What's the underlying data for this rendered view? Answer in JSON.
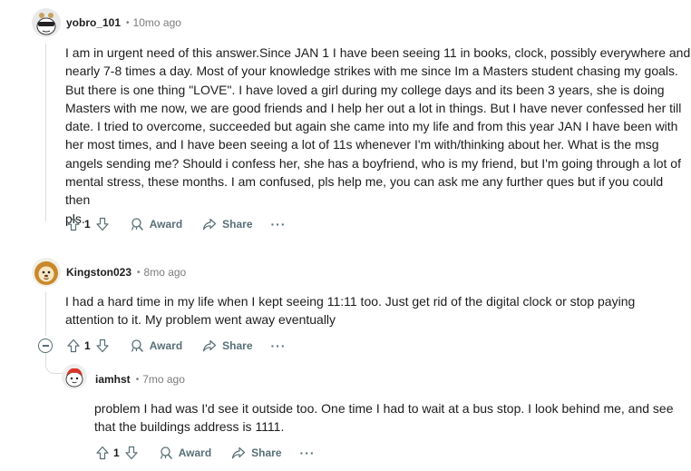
{
  "comments": [
    {
      "username": "yobro_101",
      "separator": "•",
      "time": "10mo ago",
      "avatar_icon": "snoo-avatar-shades",
      "lines": [
        "I am in urgent need of this answer.Since JAN 1 I have been seeing 11 in books, clock, possibly everywhere and",
        "nearly 7-8 times a day. Most of your knowledge strikes with me since Im a Masters student chasing my goals.",
        "But there is one thing \"LOVE\". I have loved a girl during my college days and its been 3 years, she is doing",
        "Masters with me now, we are good friends and I help her out a lot in things. But I have never confessed her till",
        "date. I tried to overcome, succeeded but again she came into my life and from this year JAN I have been with",
        "her most times, and I have been seeing a lot of 11s whenever I'm with/thinking about her. What is the msg",
        "angels sending me? Should i confess her, she has a boyfriend, who is my friend, but I'm going through a lot of",
        "mental stress, these months. I am confused, pls help me, you can ask me any further ques but if you could then",
        "pls."
      ],
      "votes": "1",
      "award_label": "Award",
      "share_label": "Share",
      "more_label": "···"
    },
    {
      "username": "Kingston023",
      "separator": "•",
      "time": "8mo ago",
      "avatar_icon": "snoo-avatar-lion",
      "lines": [
        "I had a hard time in my life when I kept seeing 11:11 too. Just get rid of the digital clock or stop paying",
        "attention to it. My problem went away eventually"
      ],
      "votes": "1",
      "award_label": "Award",
      "share_label": "Share",
      "more_label": "···"
    },
    {
      "username": "iamhst",
      "separator": "•",
      "time": "7mo ago",
      "avatar_icon": "snoo-avatar-red-hair",
      "lines": [
        "problem I had was I'd see it outside too. One time I had to wait at a bus stop. I look behind me, and see",
        "that the buildings address is 1111."
      ],
      "votes": "1",
      "award_label": "Award",
      "share_label": "Share",
      "more_label": "···"
    }
  ],
  "colors": {
    "text": "#1c1c1c",
    "meta": "#7c7c7c",
    "action": "#576f76",
    "thread": "#dcdcdc"
  }
}
